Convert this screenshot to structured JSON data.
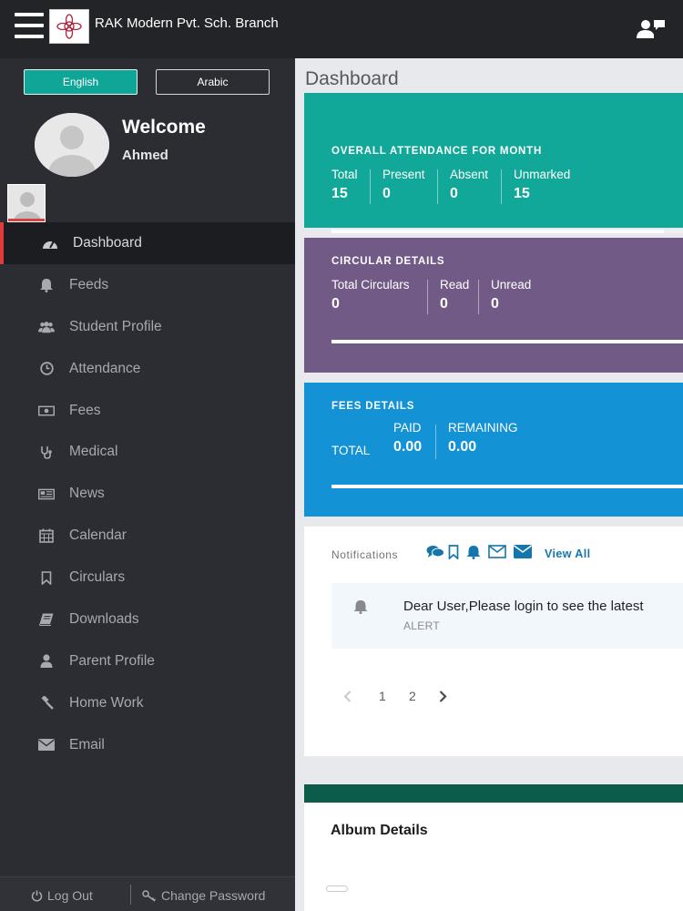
{
  "header": {
    "school_name": "RAK Modern Pvt. Sch. Branch"
  },
  "sidebar": {
    "lang_english": "English",
    "lang_arabic": "Arabic",
    "welcome": "Welcome",
    "user_name": "Ahmed",
    "items": [
      {
        "label": "Dashboard",
        "icon": "dashboard-icon",
        "active": true
      },
      {
        "label": "Feeds",
        "icon": "bell-icon"
      },
      {
        "label": "Student Profile",
        "icon": "users-icon"
      },
      {
        "label": "Attendance",
        "icon": "clock-icon"
      },
      {
        "label": "Fees",
        "icon": "money-icon"
      },
      {
        "label": "Medical",
        "icon": "stethoscope-icon"
      },
      {
        "label": "News",
        "icon": "newspaper-icon"
      },
      {
        "label": "Calendar",
        "icon": "calendar-icon"
      },
      {
        "label": "Circulars",
        "icon": "bookmark-icon"
      },
      {
        "label": "Downloads",
        "icon": "book-icon"
      },
      {
        "label": "Parent Profile",
        "icon": "user-icon"
      },
      {
        "label": "Home Work",
        "icon": "gavel-icon"
      },
      {
        "label": "Email",
        "icon": "envelope-icon"
      }
    ],
    "logout": "Log Out",
    "change_password": "Change Password"
  },
  "main": {
    "title": "Dashboard",
    "attendance": {
      "title": "OVERALL ATTENDANCE FOR  MONTH",
      "total_label": "Total",
      "total": "15",
      "present_label": "Present",
      "present": "0",
      "absent_label": "Absent",
      "absent": "0",
      "unmarked_label": "Unmarked",
      "unmarked": "15",
      "progress": 0.87,
      "color": "#12a899"
    },
    "circular": {
      "title": "CIRCULAR DETAILS",
      "total_label": "Total Circulars",
      "total": "0",
      "read_label": "Read",
      "read": "0",
      "unread_label": "Unread",
      "unread": "0",
      "progress": 1.0,
      "color": "#715b86"
    },
    "fees": {
      "title": "FEES  DETAILS",
      "total_label": "TOTAL",
      "paid_label": "PAID",
      "paid": "0.00",
      "remaining_label": "REMAINING",
      "remaining": "0.00",
      "progress": 1.0,
      "color": "#1393d6"
    },
    "notifications": {
      "label": "Notifications",
      "view_all": "View All",
      "items": [
        {
          "text": "Dear User,Please login to see the latest",
          "type": "ALERT"
        }
      ],
      "pages": [
        "1",
        "2"
      ],
      "accent": "#1576ad"
    },
    "album": {
      "title": "Album Details"
    }
  }
}
